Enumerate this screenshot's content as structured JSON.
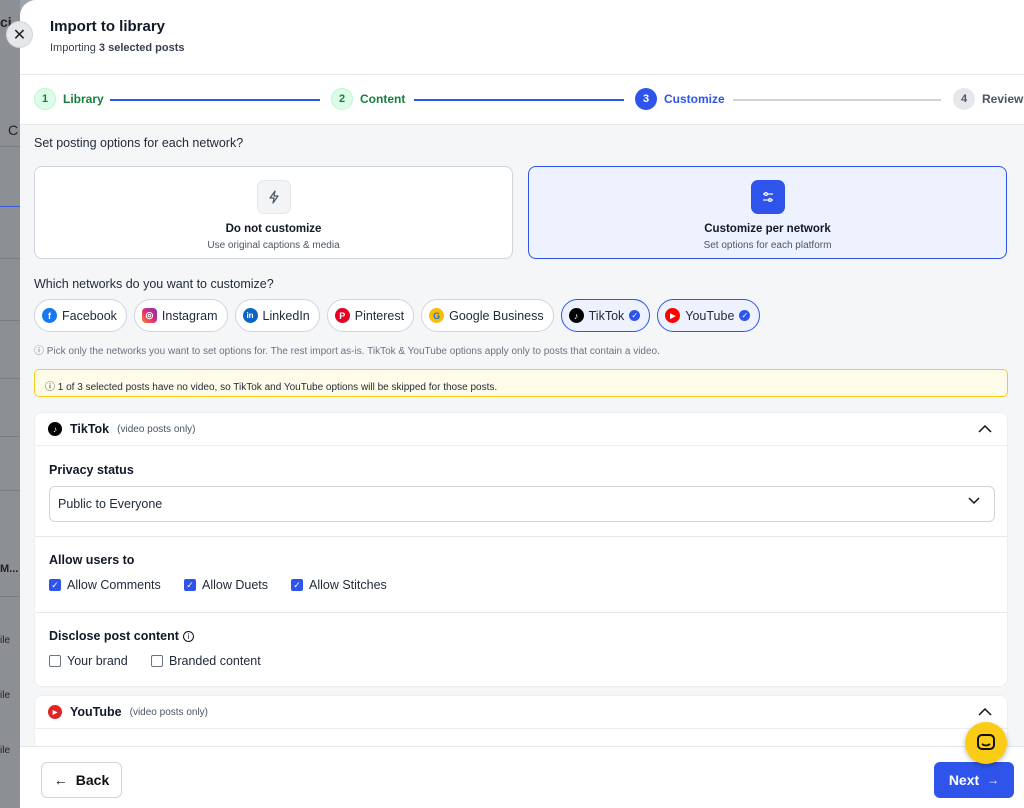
{
  "background_app": {
    "fragments": [
      "ci",
      "C",
      "M...",
      "ile",
      "ile",
      "ile"
    ]
  },
  "dialog": {
    "title": "Import to library",
    "subtitle_prefix": "Importing ",
    "subtitle_bold": "3 selected posts"
  },
  "steps": [
    {
      "num": "1",
      "label": "Library",
      "state": "done"
    },
    {
      "num": "2",
      "label": "Content",
      "state": "done"
    },
    {
      "num": "3",
      "label": "Customize",
      "state": "active"
    },
    {
      "num": "4",
      "label": "Review",
      "state": "todo"
    }
  ],
  "customize_question": "Set posting options for each network?",
  "options": {
    "no_customize": {
      "title": "Do not customize",
      "desc": "Use original captions & media",
      "icon": "bolt-icon",
      "selected": false
    },
    "per_network": {
      "title": "Customize per network",
      "desc": "Set options for each platform",
      "icon": "sliders-icon",
      "selected": true
    }
  },
  "networks_question": "Which networks do you want to customize?",
  "networks": [
    {
      "label": "Facebook",
      "color": "#1877f2",
      "glyph": "f",
      "selected": false
    },
    {
      "label": "Instagram",
      "color": "#e1306c",
      "glyph": "◎",
      "selected": false
    },
    {
      "label": "LinkedIn",
      "color": "#0a66c2",
      "glyph": "in",
      "selected": false
    },
    {
      "label": "Pinterest",
      "color": "#e60023",
      "glyph": "P",
      "selected": false
    },
    {
      "label": "Google Business",
      "color": "#fbbc04",
      "glyph": "G",
      "selected": false
    },
    {
      "label": "TikTok",
      "color": "#000000",
      "glyph": "♪",
      "selected": true
    },
    {
      "label": "YouTube",
      "color": "#ff0000",
      "glyph": "▶",
      "selected": true
    }
  ],
  "hint": "ⓘ Pick only the networks you want to set options for. The rest import as-is. TikTok & YouTube options apply only to posts that contain a video.",
  "warning": "ⓘ 1 of 3 selected posts have no video, so TikTok and YouTube options will be skipped for those posts.",
  "tiktok": {
    "name": "TikTok",
    "note": "(video posts only)",
    "privacy_label": "Privacy status",
    "privacy_value": "Public to Everyone",
    "allow_label": "Allow users to",
    "allow": [
      {
        "label": "Allow Comments",
        "checked": true
      },
      {
        "label": "Allow Duets",
        "checked": true
      },
      {
        "label": "Allow Stitches",
        "checked": true
      }
    ],
    "disclose_label": "Disclose post content",
    "disclose": [
      {
        "label": "Your brand",
        "checked": false
      },
      {
        "label": "Branded content",
        "checked": false
      }
    ]
  },
  "youtube": {
    "name": "YouTube",
    "note": "(video posts only)"
  },
  "footer": {
    "back": "Back",
    "next": "Next"
  },
  "colors": {
    "accent": "#2f54eb",
    "done": "#15803d",
    "warning_bg": "#fefce8",
    "chat": "#facc15"
  }
}
